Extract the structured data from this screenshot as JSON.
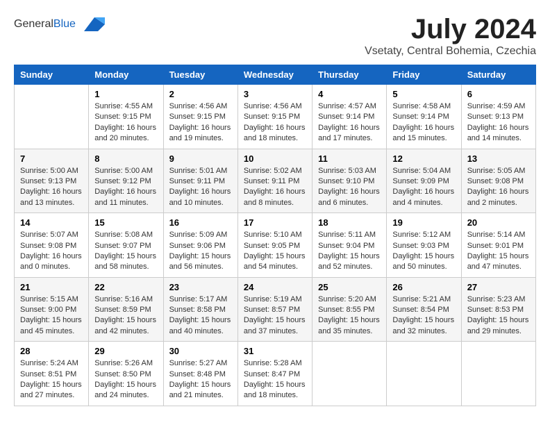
{
  "header": {
    "logo_general": "General",
    "logo_blue": "Blue",
    "month_year": "July 2024",
    "location": "Vsetaty, Central Bohemia, Czechia"
  },
  "days_of_week": [
    "Sunday",
    "Monday",
    "Tuesday",
    "Wednesday",
    "Thursday",
    "Friday",
    "Saturday"
  ],
  "weeks": [
    [
      {
        "day": "",
        "info": ""
      },
      {
        "day": "1",
        "info": "Sunrise: 4:55 AM\nSunset: 9:15 PM\nDaylight: 16 hours\nand 20 minutes."
      },
      {
        "day": "2",
        "info": "Sunrise: 4:56 AM\nSunset: 9:15 PM\nDaylight: 16 hours\nand 19 minutes."
      },
      {
        "day": "3",
        "info": "Sunrise: 4:56 AM\nSunset: 9:15 PM\nDaylight: 16 hours\nand 18 minutes."
      },
      {
        "day": "4",
        "info": "Sunrise: 4:57 AM\nSunset: 9:14 PM\nDaylight: 16 hours\nand 17 minutes."
      },
      {
        "day": "5",
        "info": "Sunrise: 4:58 AM\nSunset: 9:14 PM\nDaylight: 16 hours\nand 15 minutes."
      },
      {
        "day": "6",
        "info": "Sunrise: 4:59 AM\nSunset: 9:13 PM\nDaylight: 16 hours\nand 14 minutes."
      }
    ],
    [
      {
        "day": "7",
        "info": "Sunrise: 5:00 AM\nSunset: 9:13 PM\nDaylight: 16 hours\nand 13 minutes."
      },
      {
        "day": "8",
        "info": "Sunrise: 5:00 AM\nSunset: 9:12 PM\nDaylight: 16 hours\nand 11 minutes."
      },
      {
        "day": "9",
        "info": "Sunrise: 5:01 AM\nSunset: 9:11 PM\nDaylight: 16 hours\nand 10 minutes."
      },
      {
        "day": "10",
        "info": "Sunrise: 5:02 AM\nSunset: 9:11 PM\nDaylight: 16 hours\nand 8 minutes."
      },
      {
        "day": "11",
        "info": "Sunrise: 5:03 AM\nSunset: 9:10 PM\nDaylight: 16 hours\nand 6 minutes."
      },
      {
        "day": "12",
        "info": "Sunrise: 5:04 AM\nSunset: 9:09 PM\nDaylight: 16 hours\nand 4 minutes."
      },
      {
        "day": "13",
        "info": "Sunrise: 5:05 AM\nSunset: 9:08 PM\nDaylight: 16 hours\nand 2 minutes."
      }
    ],
    [
      {
        "day": "14",
        "info": "Sunrise: 5:07 AM\nSunset: 9:08 PM\nDaylight: 16 hours\nand 0 minutes."
      },
      {
        "day": "15",
        "info": "Sunrise: 5:08 AM\nSunset: 9:07 PM\nDaylight: 15 hours\nand 58 minutes."
      },
      {
        "day": "16",
        "info": "Sunrise: 5:09 AM\nSunset: 9:06 PM\nDaylight: 15 hours\nand 56 minutes."
      },
      {
        "day": "17",
        "info": "Sunrise: 5:10 AM\nSunset: 9:05 PM\nDaylight: 15 hours\nand 54 minutes."
      },
      {
        "day": "18",
        "info": "Sunrise: 5:11 AM\nSunset: 9:04 PM\nDaylight: 15 hours\nand 52 minutes."
      },
      {
        "day": "19",
        "info": "Sunrise: 5:12 AM\nSunset: 9:03 PM\nDaylight: 15 hours\nand 50 minutes."
      },
      {
        "day": "20",
        "info": "Sunrise: 5:14 AM\nSunset: 9:01 PM\nDaylight: 15 hours\nand 47 minutes."
      }
    ],
    [
      {
        "day": "21",
        "info": "Sunrise: 5:15 AM\nSunset: 9:00 PM\nDaylight: 15 hours\nand 45 minutes."
      },
      {
        "day": "22",
        "info": "Sunrise: 5:16 AM\nSunset: 8:59 PM\nDaylight: 15 hours\nand 42 minutes."
      },
      {
        "day": "23",
        "info": "Sunrise: 5:17 AM\nSunset: 8:58 PM\nDaylight: 15 hours\nand 40 minutes."
      },
      {
        "day": "24",
        "info": "Sunrise: 5:19 AM\nSunset: 8:57 PM\nDaylight: 15 hours\nand 37 minutes."
      },
      {
        "day": "25",
        "info": "Sunrise: 5:20 AM\nSunset: 8:55 PM\nDaylight: 15 hours\nand 35 minutes."
      },
      {
        "day": "26",
        "info": "Sunrise: 5:21 AM\nSunset: 8:54 PM\nDaylight: 15 hours\nand 32 minutes."
      },
      {
        "day": "27",
        "info": "Sunrise: 5:23 AM\nSunset: 8:53 PM\nDaylight: 15 hours\nand 29 minutes."
      }
    ],
    [
      {
        "day": "28",
        "info": "Sunrise: 5:24 AM\nSunset: 8:51 PM\nDaylight: 15 hours\nand 27 minutes."
      },
      {
        "day": "29",
        "info": "Sunrise: 5:26 AM\nSunset: 8:50 PM\nDaylight: 15 hours\nand 24 minutes."
      },
      {
        "day": "30",
        "info": "Sunrise: 5:27 AM\nSunset: 8:48 PM\nDaylight: 15 hours\nand 21 minutes."
      },
      {
        "day": "31",
        "info": "Sunrise: 5:28 AM\nSunset: 8:47 PM\nDaylight: 15 hours\nand 18 minutes."
      },
      {
        "day": "",
        "info": ""
      },
      {
        "day": "",
        "info": ""
      },
      {
        "day": "",
        "info": ""
      }
    ]
  ]
}
